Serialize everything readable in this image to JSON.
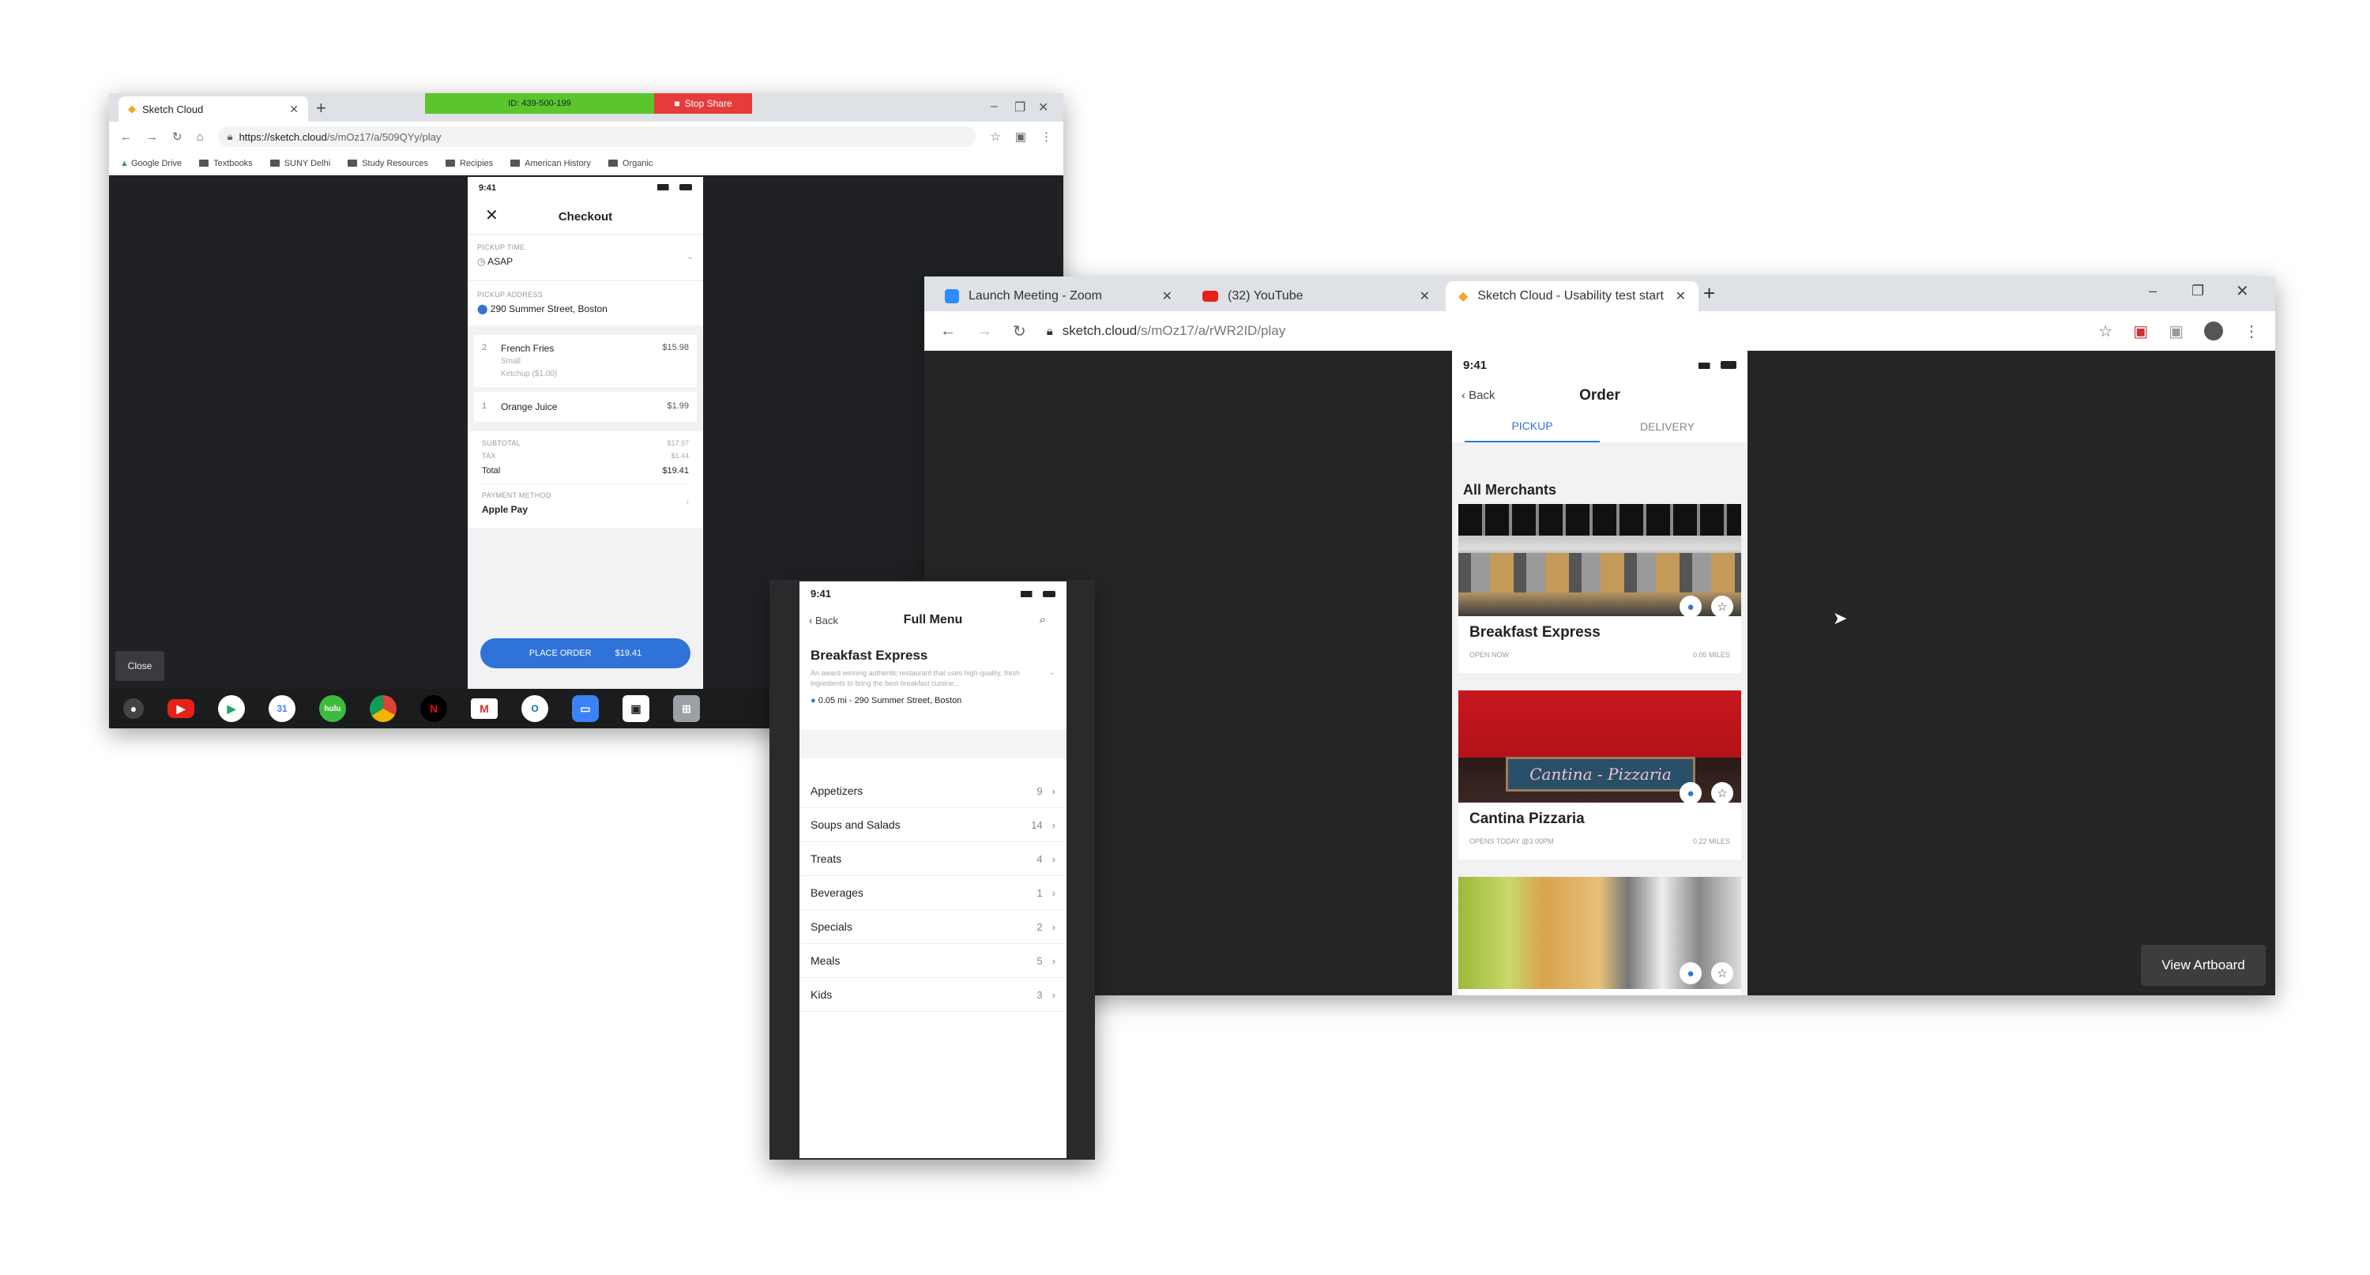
{
  "win1": {
    "tab_title": "Sketch Cloud",
    "zoom_id": "ID: 439-500-199",
    "stop_share": "Stop Share",
    "url_host": "https://sketch.cloud",
    "url_path": "/s/mOz17/a/509QYy/play",
    "bookmarks": [
      "Google Drive",
      "Textbooks",
      "SUNY Delhi",
      "Study Resources",
      "Recipies",
      "American History",
      "Organic"
    ],
    "close_label": "Close",
    "checkout": {
      "time": "9:41",
      "title": "Checkout",
      "pickup_time_label": "PICKUP TIME",
      "pickup_time": "ASAP",
      "pickup_address_label": "PICKUP ADDRESS",
      "pickup_address": "290 Summer Street, Boston",
      "items": [
        {
          "qty": "2",
          "name": "French Fries",
          "price": "$15.98",
          "sub1": "Small",
          "sub2": "Ketchup ($1.00)"
        },
        {
          "qty": "1",
          "name": "Orange Juice",
          "price": "$1.99"
        }
      ],
      "subtotal_label": "SUBTOTAL",
      "subtotal": "$17.97",
      "tax_label": "TAX",
      "tax": "$1.44",
      "total_label": "Total",
      "total": "$19.41",
      "payment_label": "PAYMENT METHOD",
      "payment": "Apple Pay",
      "place_order": "PLACE ORDER",
      "place_order_amount": "$19.41"
    }
  },
  "win2": {
    "tabs": [
      "Launch Meeting - Zoom",
      "(32) YouTube",
      "Sketch Cloud - Usability test start"
    ],
    "url_host": "sketch.cloud",
    "url_path": "/s/mOz17/a/rWR2ID/play",
    "view_artboard": "View Artboard",
    "order": {
      "time": "9:41",
      "back": "Back",
      "title": "Order",
      "tab_pickup": "PICKUP",
      "tab_delivery": "DELIVERY",
      "section": "All Merchants",
      "merchants": [
        {
          "name": "Breakfast Express",
          "status": "OPEN NOW",
          "distance": "0.05 MILES"
        },
        {
          "name": "Cantina Pizzaria",
          "status": "OPENS TODAY @3:00PM",
          "distance": "0.22 MILES"
        }
      ],
      "sign_text": "Cantina - Pizzaria"
    }
  },
  "win3": {
    "time": "9:41",
    "back": "Back",
    "title": "Full Menu",
    "restaurant": "Breakfast Express",
    "description": "An award winning authentic restaurant that uses high-quality, fresh ingredients to bring the best breakfast cuisine...",
    "location": "0.05 mi - 290 Summer Street, Boston",
    "categories": [
      {
        "name": "Appetizers",
        "count": "9"
      },
      {
        "name": "Soups and Salads",
        "count": "14"
      },
      {
        "name": "Treats",
        "count": "4"
      },
      {
        "name": "Beverages",
        "count": "1"
      },
      {
        "name": "Specials",
        "count": "2"
      },
      {
        "name": "Meals",
        "count": "5"
      },
      {
        "name": "Kids",
        "count": "3"
      }
    ]
  },
  "colors": {
    "accent": "#2f73d9",
    "zoom_green": "#5ac62b",
    "stop_red": "#e63b3b"
  }
}
